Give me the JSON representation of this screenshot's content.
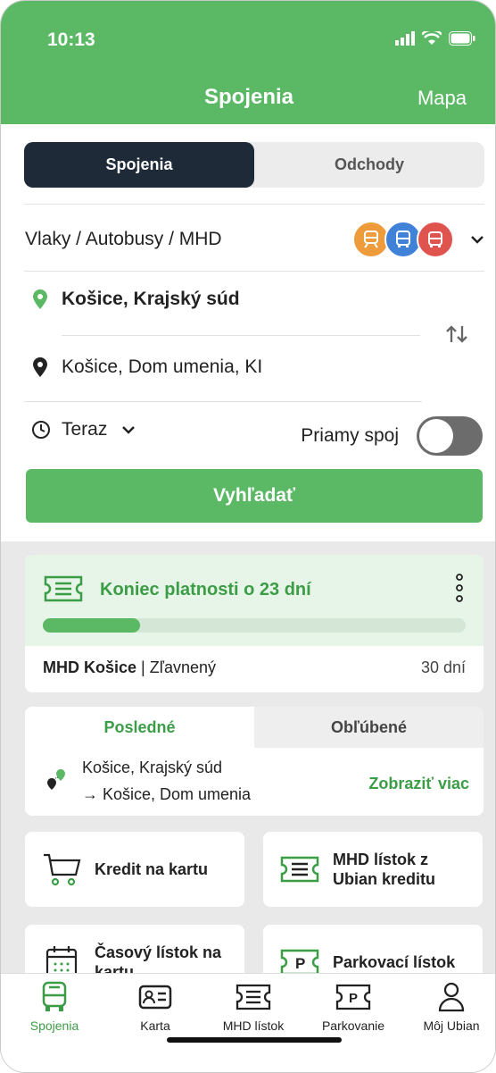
{
  "status_bar": {
    "time": "10:13"
  },
  "header": {
    "title": "Spojenia",
    "map_link": "Mapa"
  },
  "segment": {
    "tabs": [
      "Spojenia",
      "Odchody"
    ],
    "active": "Spojenia"
  },
  "transport": {
    "label": "Vlaky / Autobusy / MHD",
    "icons": [
      "train-icon",
      "bus-icon",
      "tram-icon"
    ]
  },
  "route": {
    "from": "Košice, Krajský súd",
    "to": "Košice, Dom umenia, KI"
  },
  "time": {
    "label": "Teraz"
  },
  "direct": {
    "label": "Priamy spoj",
    "enabled": false
  },
  "search_button": "Vyhľadať",
  "ticket": {
    "title": "Koniec platnosti o 23 dní",
    "progress": 0.23,
    "name_bold": "MHD Košice",
    "name_rest": " | Zľavnený",
    "days": "30 dní"
  },
  "recent": {
    "tabs": [
      "Posledné",
      "Obľúbené"
    ],
    "from": "Košice, Krajský súd",
    "to": "→ Košice, Dom umenia",
    "show_more": "Zobraziť viac"
  },
  "tiles": [
    {
      "label": "Kredit na kartu",
      "icon": "cart-icon"
    },
    {
      "label": "MHD lístok z Ubian kreditu",
      "icon": "ticket-icon"
    },
    {
      "label": "Časový lístok na kartu",
      "icon": "calendar-icon"
    },
    {
      "label": "Parkovací lístok",
      "icon": "parking-ticket-icon"
    }
  ],
  "nav": [
    {
      "label": "Spojenia",
      "active": true
    },
    {
      "label": "Karta"
    },
    {
      "label": "MHD lístok"
    },
    {
      "label": "Parkovanie"
    },
    {
      "label": "Môj Ubian"
    }
  ],
  "colors": {
    "brand": "#5bb865",
    "dark": "#1e2a38",
    "green_text": "#3c9d47"
  }
}
